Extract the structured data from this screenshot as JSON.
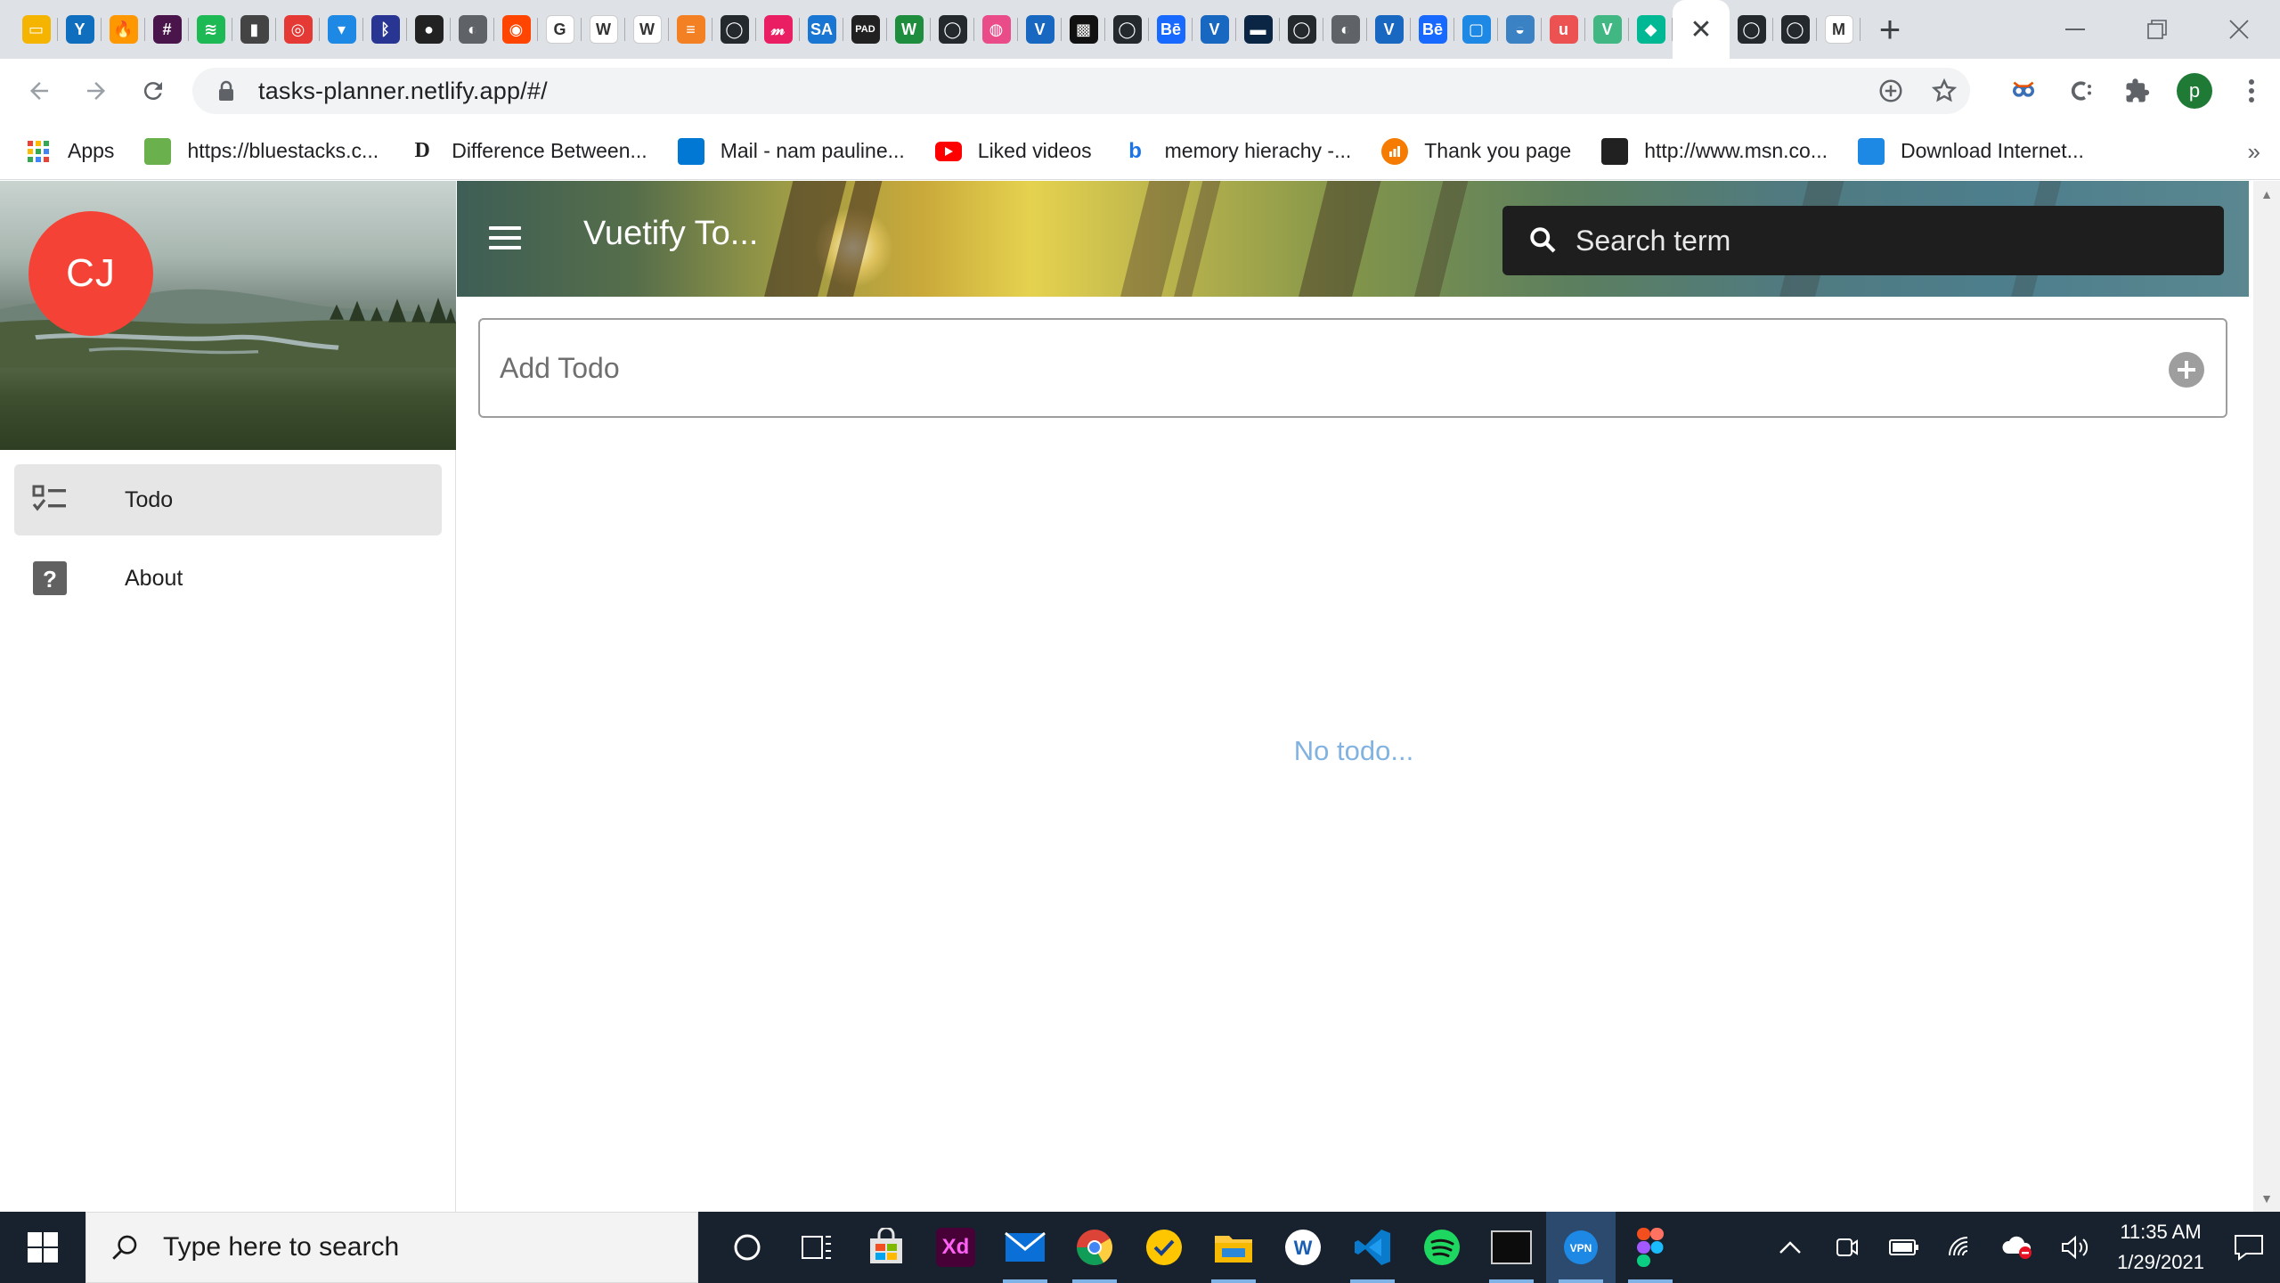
{
  "browser": {
    "tabs": [
      {
        "icon": "slides-icon",
        "color": "#f4b400",
        "glyph": "▭"
      },
      {
        "icon": "yammer-icon",
        "color": "#106ebe",
        "glyph": "Y"
      },
      {
        "icon": "flame-icon",
        "color": "#ff9800",
        "glyph": "🔥"
      },
      {
        "icon": "slack-icon",
        "color": "#4a154b",
        "glyph": "#"
      },
      {
        "icon": "spotify-icon",
        "color": "#1db954",
        "glyph": "≋"
      },
      {
        "icon": "books-icon",
        "color": "#444444",
        "glyph": "▮"
      },
      {
        "icon": "target-icon",
        "color": "#e53935",
        "glyph": "◎"
      },
      {
        "icon": "bucket-icon",
        "color": "#1e88e5",
        "glyph": "▾"
      },
      {
        "icon": "bluetooth-icon",
        "color": "#283593",
        "glyph": "ᛒ"
      },
      {
        "icon": "circles-icon",
        "color": "#222222",
        "glyph": "●"
      },
      {
        "icon": "globe-icon",
        "color": "#5f6368",
        "glyph": "◐"
      },
      {
        "icon": "reddit-icon",
        "color": "#ff4500",
        "glyph": "◉"
      },
      {
        "icon": "google-icon",
        "color": "#ffffff",
        "glyph": "G"
      },
      {
        "icon": "wikipedia-icon",
        "color": "#ffffff",
        "glyph": "W"
      },
      {
        "icon": "wikipedia-icon",
        "color": "#ffffff",
        "glyph": "W"
      },
      {
        "icon": "stackoverflow-icon",
        "color": "#f48024",
        "glyph": "≡"
      },
      {
        "icon": "github-icon",
        "color": "#24292e",
        "glyph": "◯"
      },
      {
        "icon": "miro-icon",
        "color": "#e91e63",
        "glyph": "𝓂"
      },
      {
        "icon": "sa-icon",
        "color": "#1976d2",
        "glyph": "SA"
      },
      {
        "icon": "pad-icon",
        "color": "#212121",
        "glyph": "PAD"
      },
      {
        "icon": "wrike-icon",
        "color": "#1e8e3e",
        "glyph": "W"
      },
      {
        "icon": "github-icon",
        "color": "#24292e",
        "glyph": "◯"
      },
      {
        "icon": "dribbble-icon",
        "color": "#ea4c89",
        "glyph": "◍"
      },
      {
        "icon": "vuetify-icon",
        "color": "#1867c0",
        "glyph": "V"
      },
      {
        "icon": "pattern-icon",
        "color": "#111111",
        "glyph": "▩"
      },
      {
        "icon": "github-icon",
        "color": "#24292e",
        "glyph": "◯"
      },
      {
        "icon": "behance-icon",
        "color": "#1769ff",
        "glyph": "Bē"
      },
      {
        "icon": "vuetify-icon",
        "color": "#1867c0",
        "glyph": "V"
      },
      {
        "icon": "minus-icon",
        "color": "#0b2545",
        "glyph": "▬"
      },
      {
        "icon": "github-icon",
        "color": "#24292e",
        "glyph": "◯"
      },
      {
        "icon": "globe-icon",
        "color": "#5f6368",
        "glyph": "◐"
      },
      {
        "icon": "vuetify-icon",
        "color": "#1867c0",
        "glyph": "V"
      },
      {
        "icon": "behance-icon",
        "color": "#1769ff",
        "glyph": "Bē"
      },
      {
        "icon": "frame-icon",
        "color": "#1e88e5",
        "glyph": "▢"
      },
      {
        "icon": "swift-icon",
        "color": "#3b82c4",
        "glyph": "◒"
      },
      {
        "icon": "udemy-icon",
        "color": "#ec5252",
        "glyph": "u"
      },
      {
        "icon": "vue-icon",
        "color": "#41b883",
        "glyph": "V"
      },
      {
        "icon": "diamond-icon",
        "color": "#00b894",
        "glyph": "◆"
      }
    ],
    "active_tab_close": "✕",
    "after_tabs": [
      {
        "icon": "github-icon",
        "color": "#24292e",
        "glyph": "◯"
      },
      {
        "icon": "github-icon",
        "color": "#24292e",
        "glyph": "◯"
      },
      {
        "icon": "gmail-icon",
        "color": "#ffffff",
        "glyph": "M"
      }
    ],
    "new_tab": "+",
    "url": "tasks-planner.netlify.app/#/",
    "profile_initial": "p",
    "bookmarks": [
      {
        "icon": "apps-icon",
        "color": "#ffffff",
        "label": "Apps"
      },
      {
        "icon": "bluestacks-icon",
        "color": "#6ab04c",
        "label": "https://bluestacks.c..."
      },
      {
        "icon": "difference-icon",
        "color": "#ffffff",
        "label": "Difference Between..."
      },
      {
        "icon": "outlook-icon",
        "color": "#0078d4",
        "label": "Mail - nam pauline..."
      },
      {
        "icon": "youtube-icon",
        "color": "#ff0000",
        "label": "Liked videos"
      },
      {
        "icon": "bing-icon",
        "color": "#ffffff",
        "label": "memory hierachy -..."
      },
      {
        "icon": "chart-icon",
        "color": "#f57c00",
        "label": "Thank you page"
      },
      {
        "icon": "msn-icon",
        "color": "#212121",
        "label": "http://www.msn.co..."
      },
      {
        "icon": "ie-icon",
        "color": "#1e88e5",
        "label": "Download Internet..."
      }
    ],
    "bookmarks_more": "»"
  },
  "app": {
    "avatar_initials": "CJ",
    "nav": [
      {
        "label": "Todo",
        "icon": "checklist-icon",
        "active": true
      },
      {
        "label": "About",
        "icon": "help-box-icon",
        "active": false
      }
    ],
    "title": "Vuetify To...",
    "search_placeholder": "Search term",
    "add_placeholder": "Add Todo",
    "empty_message": "No todo..."
  },
  "taskbar": {
    "search_placeholder": "Type here to search",
    "time": "11:35 AM",
    "date": "1/29/2021"
  }
}
